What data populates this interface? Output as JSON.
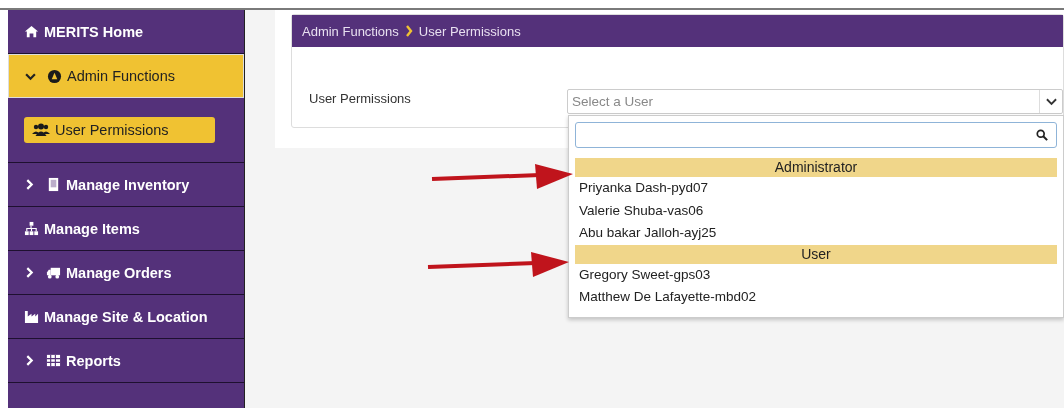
{
  "sidebar": {
    "items": [
      {
        "label": "MERITS Home",
        "selected": false
      },
      {
        "label": "Admin Functions",
        "expanded": true,
        "selected": true,
        "children": [
          {
            "label": "User Permissions",
            "selected": true
          }
        ]
      },
      {
        "label": "Manage Inventory",
        "expanded": false,
        "selected": false
      },
      {
        "label": "Manage Items",
        "selected": false
      },
      {
        "label": "Manage Orders",
        "expanded": false,
        "selected": false
      },
      {
        "label": "Manage Site & Location",
        "selected": false
      },
      {
        "label": "Reports",
        "expanded": false,
        "selected": false
      }
    ]
  },
  "breadcrumb": [
    "Admin Functions",
    "User Permissions"
  ],
  "form": {
    "label": "User Permissions",
    "select": {
      "placeholder": "Select a User"
    }
  },
  "dropdown": {
    "groups": [
      {
        "name": "Administrator",
        "options": [
          "Priyanka Dash-pyd07",
          "Valerie Shuba-vas06",
          "Abu bakar Jalloh-ayj25"
        ]
      },
      {
        "name": "User",
        "options": [
          "Gregory Sweet-gps03",
          "Matthew De Lafayette-mbd02"
        ]
      }
    ]
  }
}
